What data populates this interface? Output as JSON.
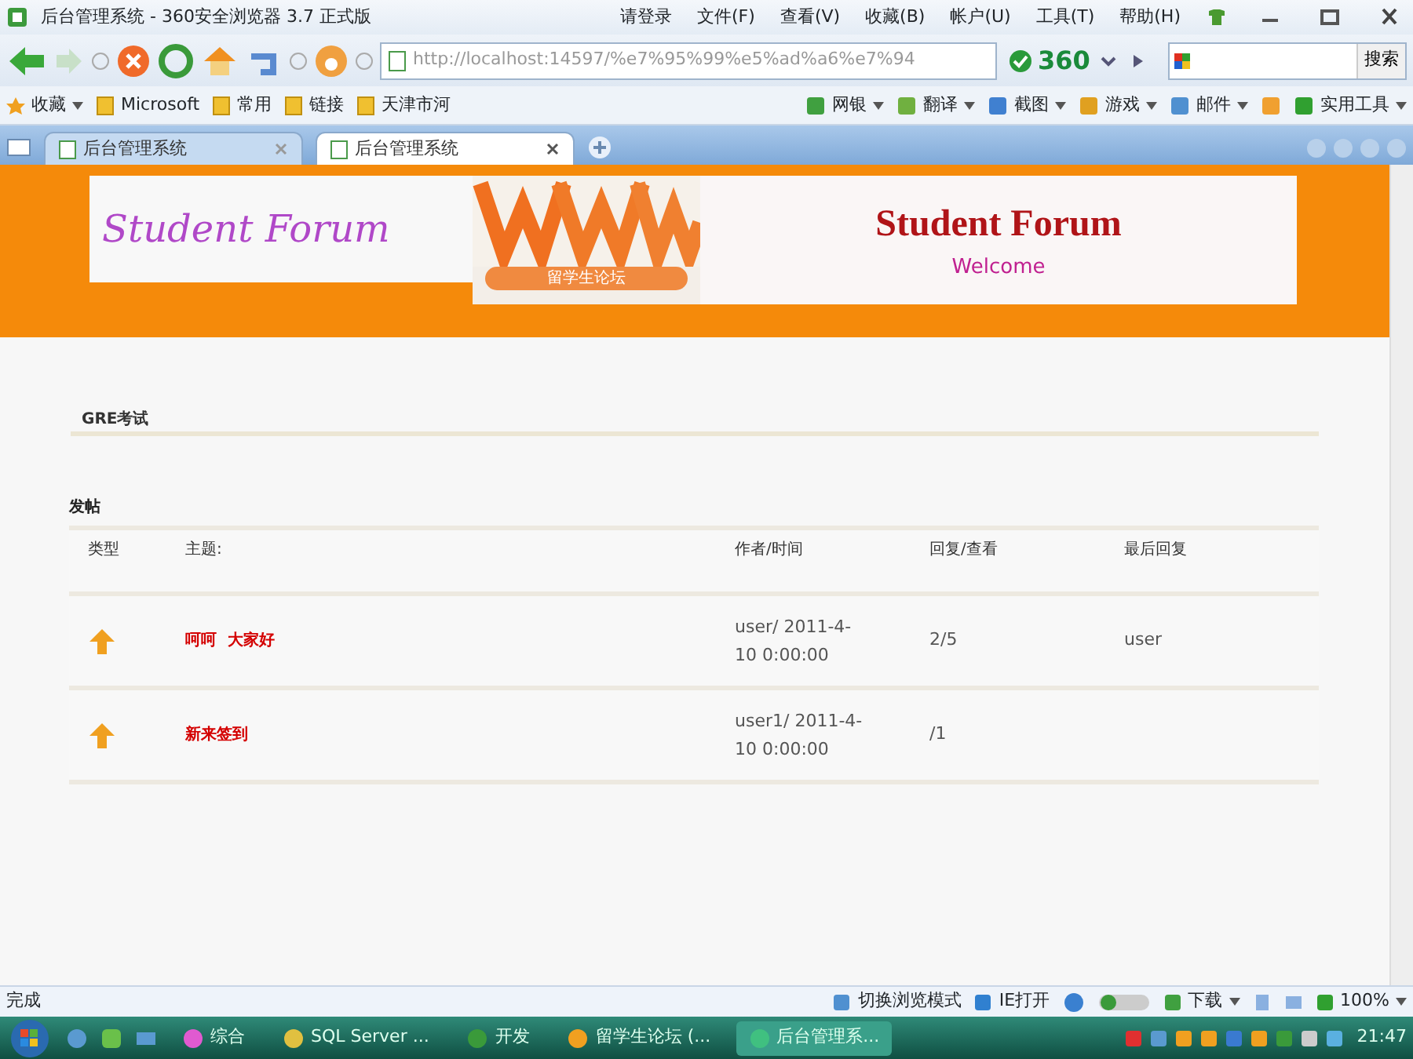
{
  "window": {
    "title": "后台管理系统 - 360安全浏览器 3.7 正式版"
  },
  "menu": [
    "请登录",
    "文件(F)",
    "查看(V)",
    "收藏(B)",
    "帐户(U)",
    "工具(T)",
    "帮助(H)"
  ],
  "address_bar": {
    "url": "http://localhost:14597/%e7%95%99%e5%ad%a6%e7%94",
    "badge": "360",
    "search_button": "搜索"
  },
  "bookmarks": [
    {
      "label": "收藏",
      "dropdown": true
    },
    {
      "label": "Microsoft",
      "dropdown": false
    },
    {
      "label": "常用",
      "dropdown": false
    },
    {
      "label": "链接",
      "dropdown": false
    },
    {
      "label": "天津市河",
      "dropdown": false
    }
  ],
  "tools": [
    "网银",
    "翻译",
    "截图",
    "游戏",
    "邮件",
    "实用工具"
  ],
  "tabs": [
    {
      "label": "后台管理系统",
      "selected": false
    },
    {
      "label": "后台管理系统",
      "selected": true
    }
  ],
  "page": {
    "banner": {
      "logo": "Student Forum",
      "caption": "留学生论坛",
      "title": "Student Forum",
      "subtitle": "Welcome"
    },
    "section_title": "GRE考试",
    "post_label": "发帖",
    "table": {
      "columns": [
        "类型",
        "主题:",
        "作者/时间",
        "回复/查看",
        "最后回复"
      ],
      "rows": [
        {
          "subject": "呵呵  大家好",
          "author_time": "user/ 2011-4-10 0:00:00",
          "replies_views": "2/5",
          "last_reply": "user"
        },
        {
          "subject": "新来签到",
          "author_time": "user1/ 2011-4-10 0:00:00",
          "replies_views": "/1"
        }
      ]
    }
  },
  "status_bar": {
    "text": "完成",
    "items": [
      "切换浏览模式",
      "IE打开",
      "下载",
      "100%"
    ]
  },
  "taskbar": {
    "tasks": [
      {
        "label": "综合",
        "selected": false
      },
      {
        "label": "SQL Server ...",
        "selected": false
      },
      {
        "label": "开发",
        "selected": false
      },
      {
        "label": "留学生论坛 (...",
        "selected": false
      },
      {
        "label": "后台管理系...",
        "selected": true
      }
    ],
    "clock": "21:47"
  }
}
